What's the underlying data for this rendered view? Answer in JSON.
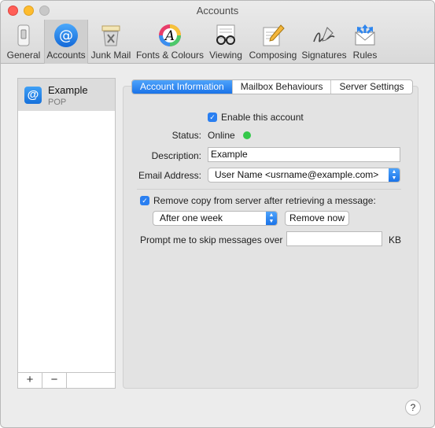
{
  "window": {
    "title": "Accounts"
  },
  "toolbar": {
    "items": [
      {
        "label": "General"
      },
      {
        "label": "Accounts"
      },
      {
        "label": "Junk Mail"
      },
      {
        "label": "Fonts & Colours"
      },
      {
        "label": "Viewing"
      },
      {
        "label": "Composing"
      },
      {
        "label": "Signatures"
      },
      {
        "label": "Rules"
      }
    ],
    "selected": "Accounts"
  },
  "sidebar": {
    "accounts": [
      {
        "name": "Example",
        "type": "POP",
        "icon": "at-sign-icon"
      }
    ],
    "add_label": "+",
    "remove_label": "−"
  },
  "tabs": [
    {
      "label": "Account Information",
      "active": true
    },
    {
      "label": "Mailbox Behaviours",
      "active": false
    },
    {
      "label": "Server Settings",
      "active": false
    }
  ],
  "account_info": {
    "enable_label": "Enable this account",
    "enable_checked": true,
    "status_label": "Status:",
    "status_value": "Online",
    "status_color": "#34c84a",
    "description_label": "Description:",
    "description_value": "Example",
    "email_label": "Email Address:",
    "email_value": "User Name <usrname@example.com>",
    "remove_copy_label": "Remove copy from server after retrieving a message:",
    "remove_copy_checked": true,
    "remove_after_value": "After one week",
    "remove_now_label": "Remove now",
    "skip_label": "Prompt me to skip messages over",
    "skip_value": "",
    "skip_unit": "KB"
  },
  "help": {
    "label": "?"
  },
  "colors": {
    "accent": "#1a73e8",
    "checkbox": "#2a7ff1"
  }
}
